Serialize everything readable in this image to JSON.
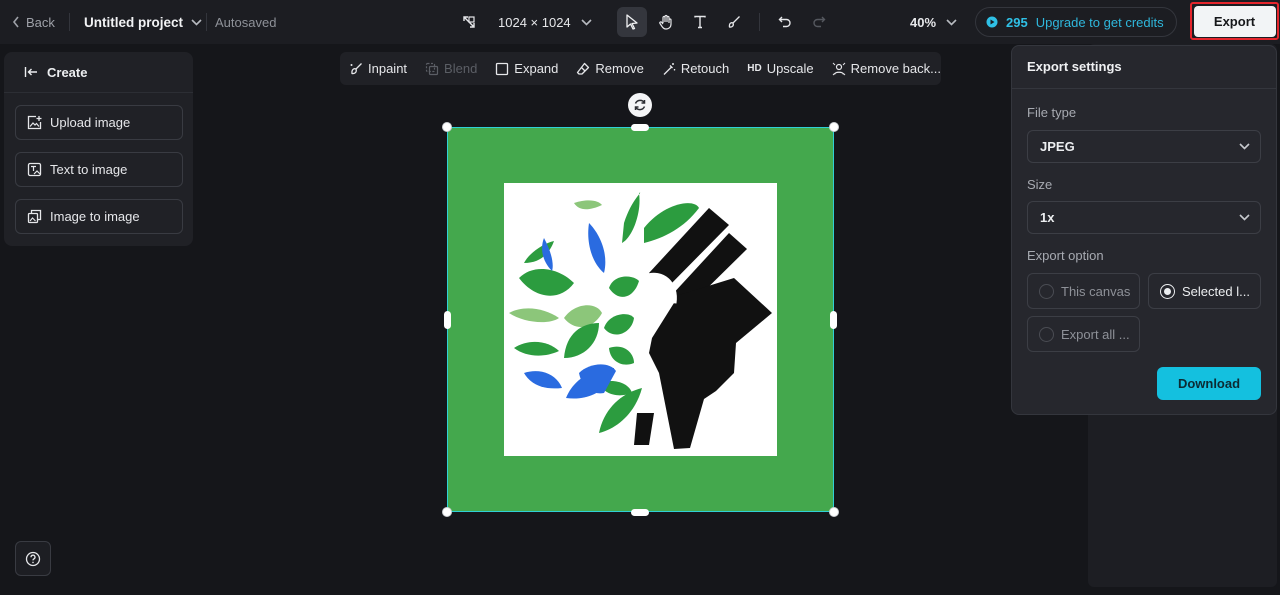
{
  "topbar": {
    "back_label": "Back",
    "project_title": "Untitled project",
    "autosaved": "Autosaved",
    "dimensions": "1024 × 1024",
    "zoom": "40%",
    "credits": "295",
    "upgrade_label": "Upgrade to get credits",
    "export_label": "Export"
  },
  "create_panel": {
    "title": "Create",
    "items": [
      {
        "label": "Upload image",
        "icon": "upload-image-icon"
      },
      {
        "label": "Text to image",
        "icon": "text-to-image-icon"
      },
      {
        "label": "Image to image",
        "icon": "image-to-image-icon"
      }
    ]
  },
  "image_toolbar": {
    "items": [
      {
        "label": "Inpaint",
        "icon": "inpaint-icon",
        "disabled": false
      },
      {
        "label": "Blend",
        "icon": "blend-icon",
        "disabled": true
      },
      {
        "label": "Expand",
        "icon": "expand-icon",
        "disabled": false
      },
      {
        "label": "Remove",
        "icon": "eraser-icon",
        "disabled": false
      },
      {
        "label": "Retouch",
        "icon": "retouch-icon",
        "disabled": false
      },
      {
        "label": "Upscale",
        "icon": "hd-icon",
        "icon_text": "HD",
        "disabled": false
      },
      {
        "label": "Remove back...",
        "icon": "remove-background-icon",
        "disabled": false
      }
    ]
  },
  "export_panel": {
    "title": "Export settings",
    "file_type_label": "File type",
    "file_type_value": "JPEG",
    "size_label": "Size",
    "size_value": "1x",
    "export_option_label": "Export option",
    "options": [
      {
        "label": "This canvas",
        "selected": false
      },
      {
        "label": "Selected l...",
        "selected": true
      },
      {
        "label": "Export all ...",
        "selected": false
      }
    ],
    "download_label": "Download"
  },
  "colors": {
    "accent": "#14c0df",
    "artboard_green": "#44a84d",
    "selection_border": "#2fd0d5",
    "export_highlight": "#e5262d"
  }
}
